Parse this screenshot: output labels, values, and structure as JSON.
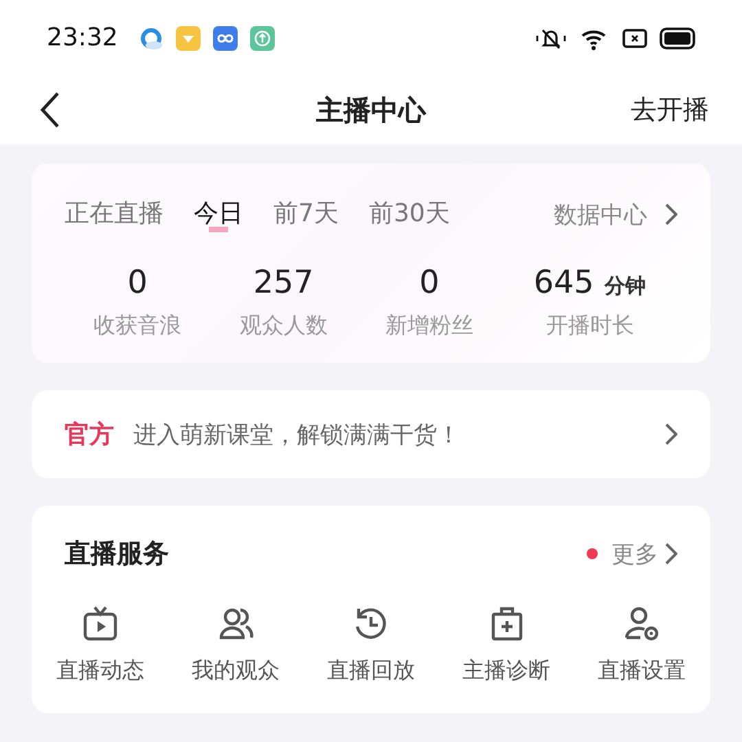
{
  "status_bar": {
    "time": "23:32"
  },
  "nav": {
    "title": "主播中心",
    "action": "去开播"
  },
  "stats_card": {
    "tabs": [
      {
        "label": "正在直播",
        "selected": false
      },
      {
        "label": "今日",
        "selected": true
      },
      {
        "label": "前7天",
        "selected": false
      },
      {
        "label": "前30天",
        "selected": false
      }
    ],
    "link": "数据中心",
    "stats": [
      {
        "value": "0",
        "label": "收获音浪"
      },
      {
        "value": "257",
        "label": "观众人数"
      },
      {
        "value": "0",
        "label": "新增粉丝"
      },
      {
        "value": "645",
        "unit": "分钟",
        "label": "开播时长"
      }
    ]
  },
  "banner": {
    "tag": "官方",
    "text": "进入萌新课堂，解锁满满干货！"
  },
  "services": {
    "title": "直播服务",
    "more": "更多",
    "more_dot": true,
    "items": [
      {
        "kind": "tv",
        "label": "直播动态"
      },
      {
        "kind": "audience",
        "label": "我的观众"
      },
      {
        "kind": "history",
        "label": "直播回放"
      },
      {
        "kind": "medkit",
        "label": "主播诊断"
      },
      {
        "kind": "usersettings",
        "label": "直播设置"
      }
    ]
  }
}
